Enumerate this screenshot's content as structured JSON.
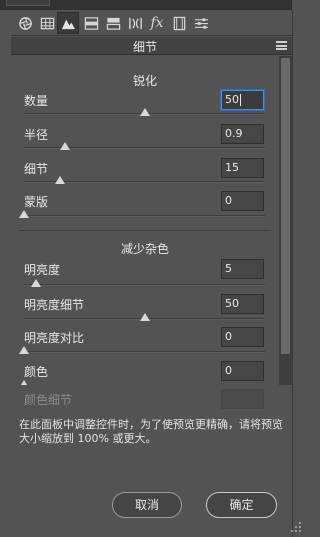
{
  "window": {
    "title": "细节"
  },
  "toolbar": {
    "tools": [
      {
        "name": "aperture-icon",
        "active": false
      },
      {
        "name": "grid-icon",
        "active": false
      },
      {
        "name": "mountain-detail-icon",
        "active": true
      },
      {
        "name": "hsl-icon",
        "active": false
      },
      {
        "name": "split-tone-icon",
        "active": false
      },
      {
        "name": "lens-icon",
        "active": false
      },
      {
        "name": "fx-icon",
        "active": false
      },
      {
        "name": "film-icon",
        "active": false
      },
      {
        "name": "sliders-icon",
        "active": false
      }
    ],
    "fx_label": "fx"
  },
  "sharpen": {
    "title": "锐化",
    "amount": {
      "label": "数量",
      "value": "50",
      "level": 0.5
    },
    "radius": {
      "label": "半径",
      "value": "0.9",
      "level": 0.17
    },
    "detail": {
      "label": "细节",
      "value": "15",
      "level": 0.15
    },
    "masking": {
      "label": "蒙版",
      "value": "0",
      "level": 0.0
    }
  },
  "noise": {
    "title": "减少杂色",
    "luminance": {
      "label": "明亮度",
      "value": "5",
      "level": 0.05
    },
    "luminance_detail": {
      "label": "明亮度细节",
      "value": "50",
      "level": 0.5
    },
    "luminance_contrast": {
      "label": "明亮度对比",
      "value": "0",
      "level": 0.0
    },
    "color": {
      "label": "颜色",
      "value": "0",
      "level": 0.0
    },
    "color_detail": {
      "label": "颜色细节",
      "value": ""
    }
  },
  "note": "在此面板中调整控件时，为了使预览更精确，请将预览大小缩放到 100% 或更大。",
  "buttons": {
    "cancel": "取消",
    "ok": "确定"
  },
  "colors": {
    "focus": "#4a8de0",
    "panel": "#535353",
    "dark": "#3a3a3a"
  }
}
